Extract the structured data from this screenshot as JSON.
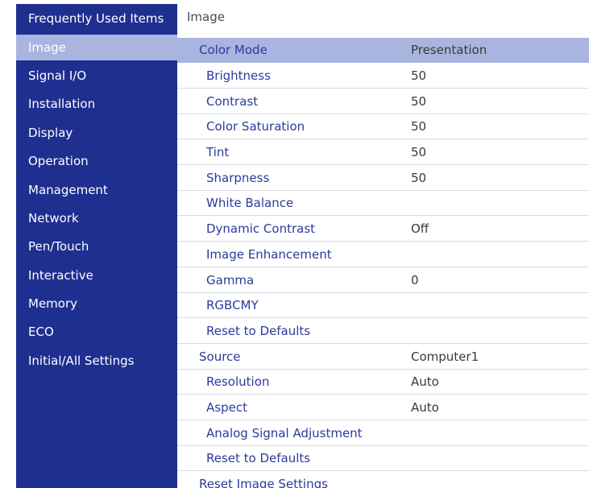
{
  "sidebar": {
    "items": [
      {
        "label": "Frequently Used Items"
      },
      {
        "label": "Image"
      },
      {
        "label": "Signal I/O"
      },
      {
        "label": "Installation"
      },
      {
        "label": "Display"
      },
      {
        "label": "Operation"
      },
      {
        "label": "Management"
      },
      {
        "label": "Network"
      },
      {
        "label": "Pen/Touch"
      },
      {
        "label": "Interactive"
      },
      {
        "label": "Memory"
      },
      {
        "label": "ECO"
      },
      {
        "label": "Initial/All Settings"
      }
    ],
    "selected": "Image"
  },
  "main": {
    "title": "Image",
    "rows": [
      {
        "label": "Color Mode",
        "value": "Presentation"
      },
      {
        "label": "Brightness",
        "value": "50"
      },
      {
        "label": "Contrast",
        "value": "50"
      },
      {
        "label": "Color Saturation",
        "value": "50"
      },
      {
        "label": "Tint",
        "value": "50"
      },
      {
        "label": "Sharpness",
        "value": "50"
      },
      {
        "label": "White Balance",
        "value": ""
      },
      {
        "label": "Dynamic Contrast",
        "value": "Off"
      },
      {
        "label": "Image Enhancement",
        "value": ""
      },
      {
        "label": "Gamma",
        "value": "0"
      },
      {
        "label": "RGBCMY",
        "value": ""
      },
      {
        "label": "Reset to Defaults",
        "value": ""
      },
      {
        "label": "Source",
        "value": "Computer1"
      },
      {
        "label": "Resolution",
        "value": "Auto"
      },
      {
        "label": "Aspect",
        "value": "Auto"
      },
      {
        "label": "Analog Signal Adjustment",
        "value": ""
      },
      {
        "label": "Reset to Defaults",
        "value": ""
      },
      {
        "label": "Reset Image Settings",
        "value": ""
      }
    ]
  },
  "colors": {
    "sidebar_bg": "#1f2f90",
    "selection": "#a8b5df",
    "label_text": "#2d3a9c"
  }
}
